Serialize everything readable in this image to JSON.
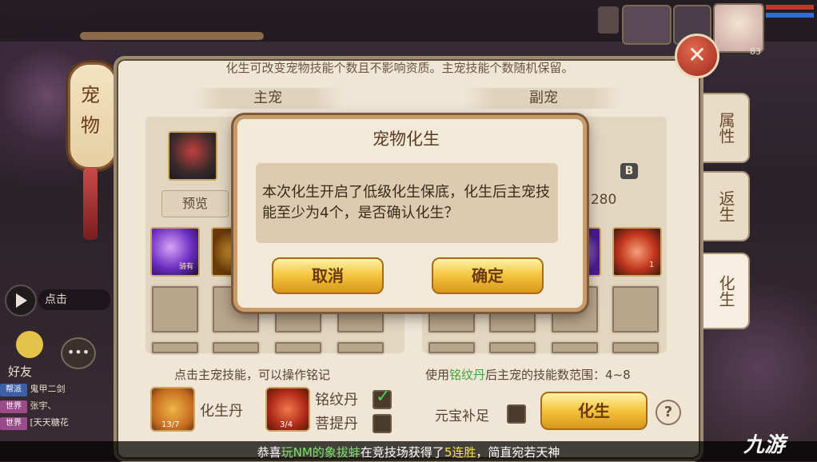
{
  "hud": {
    "level": "83",
    "chat_button_text": "点击",
    "friends_label": "好友",
    "chat_lines": [
      {
        "tag": "帮派",
        "tag_color": "#3d5fa8",
        "text": "鬼甲二剑"
      },
      {
        "tag": "世界",
        "tag_color": "#9a4b8a",
        "text": "张宇、"
      },
      {
        "tag": "世界",
        "tag_color": "#9a4b8a",
        "text": "[天天糖花"
      }
    ]
  },
  "lantern": {
    "text": "宠物"
  },
  "panel": {
    "subtitle": "化生可改变宠物技能个数且不影响资质。主宠技能个数随机保留。",
    "close_icon": "close-x-icon",
    "main_pet_header": "主宠",
    "sub_pet_header": "副宠",
    "preview_label": "预览",
    "grade_badge": "B",
    "sub_pet_value": "2280",
    "skill_badge": "骑有",
    "skill_level": "1",
    "hint_left": "点击主宠技能，可以操作铭记",
    "hint_right_prefix": "使用",
    "hint_right_item": "铭纹丹",
    "hint_right_suffix": "后主宠的技能数范围：4~8",
    "item1": {
      "label": "化生丹",
      "count": "13/7"
    },
    "item2": {
      "count": "3/4"
    },
    "option1": {
      "label": "铭纹丹",
      "checked": true
    },
    "option2": {
      "label": "菩提丹",
      "checked": false
    },
    "yuanbao_label": "元宝补足",
    "reborn_button": "化生",
    "help_label": "?"
  },
  "tabs": [
    {
      "label": "属性",
      "active": false
    },
    {
      "label": "返生",
      "active": false
    },
    {
      "label": "化生",
      "active": true
    }
  ],
  "dialog": {
    "title": "宠物化生",
    "message": "本次化生开启了低级化生保底，化生后主宠技能至少为4个，是否确认化生？",
    "cancel": "取消",
    "confirm": "确定"
  },
  "banner": {
    "part1": "恭喜",
    "player": "玩NM的象拔蚌",
    "part2": "在竞技场获得了",
    "streak": "5连胜",
    "part3": "，简直宛若天神"
  },
  "watermark": "九游",
  "colors": {
    "accent_gold": "#f3c33c",
    "highlight_green": "#7de36a",
    "highlight_yellow": "#f6e04a",
    "close_red": "#c0392b"
  }
}
